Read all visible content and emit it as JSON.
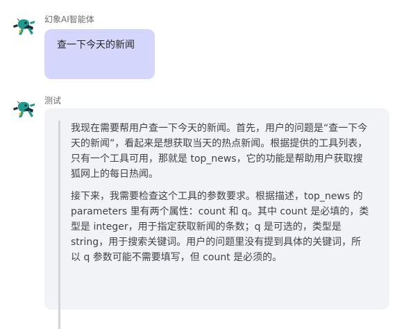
{
  "messages": [
    {
      "role": "user",
      "sender": "幻象AI智能体",
      "text": "查一下今天的新闻"
    },
    {
      "role": "assistant",
      "sender": "测试",
      "thinking": [
        "我现在需要帮用户查一下今天的新闻。首先，用户的问题是“查一下今天的新闻”，看起来是想获取当天的热点新闻。根据提供的工具列表，只有一个工具可用，那就是 top_news，它的功能是帮助用户获取搜狐网上的每日热闻。",
        "接下来，我需要检查这个工具的参数要求。根据描述，top_news 的 parameters 里有两个属性：count 和 q。其中 count 是必填的，类型是 integer，用于指定获取新闻的条数；q 是可选的，类型是 string，用于搜索关键词。用户的问题里没有提到具体的关键词，所以 q 参数可能不需要填写，但 count 是必须的。"
      ]
    }
  ],
  "avatar": {
    "icon": "mascot-icon",
    "colors": {
      "body": "#1f9a8a",
      "dark": "#1c2b3a",
      "accent": "#f4b400"
    }
  },
  "colors": {
    "user_bubble": "#d5d6fb",
    "assistant_card": "#f2f3f6",
    "quote_bar": "#d4d4d8"
  }
}
